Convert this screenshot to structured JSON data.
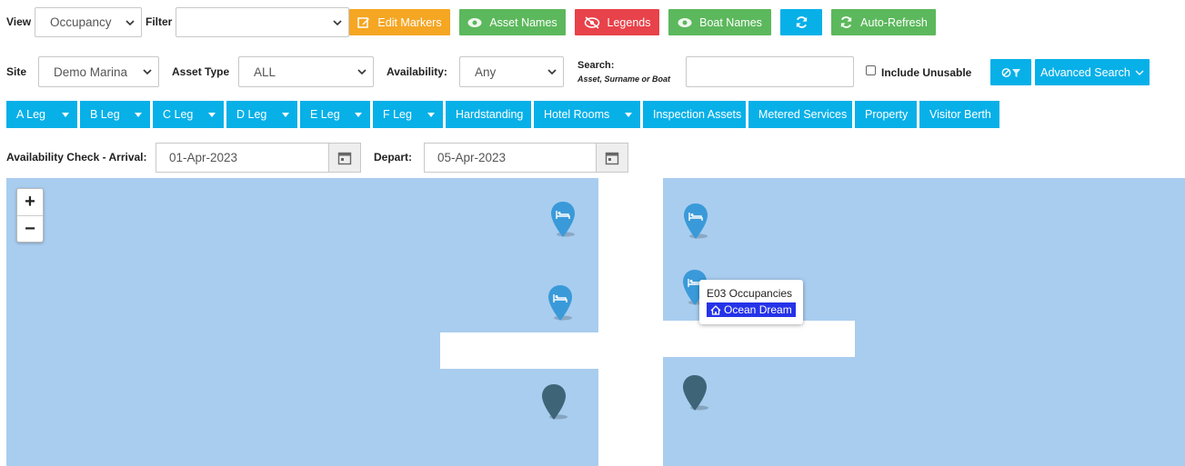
{
  "row1": {
    "view_label": "View",
    "view_value": "Occupancy",
    "filter_label": "Filter",
    "filter_value": "",
    "buttons": {
      "edit_markers": "Edit Markers",
      "asset_names": "Asset Names",
      "legends": "Legends",
      "boat_names": "Boat Names",
      "auto_refresh": "Auto-Refresh"
    },
    "colors": {
      "orange": "#f5a623",
      "green": "#5cb85c",
      "red": "#e8424a",
      "cyan": "#08b0e8"
    }
  },
  "row2": {
    "site_label": "Site",
    "site_value": "Demo Marina",
    "asset_type_label": "Asset Type",
    "asset_type_value": "ALL",
    "availability_label": "Availability:",
    "availability_value": "Any",
    "search_label": "Search:",
    "search_hint": "Asset, Surname or Boat",
    "search_value": "",
    "include_unusable_label": "Include Unusable",
    "advanced_search_label": "Advanced Search"
  },
  "legs": [
    {
      "label": "A Leg",
      "dropdown": true
    },
    {
      "label": "B Leg",
      "dropdown": true
    },
    {
      "label": "C Leg",
      "dropdown": true
    },
    {
      "label": "D Leg",
      "dropdown": true
    },
    {
      "label": "E Leg",
      "dropdown": true
    },
    {
      "label": "F Leg",
      "dropdown": true
    },
    {
      "label": "Hardstanding",
      "dropdown": false
    },
    {
      "label": "Hotel Rooms",
      "dropdown": true
    },
    {
      "label": "Inspection Assets",
      "dropdown": false
    },
    {
      "label": "Metered Services",
      "dropdown": false
    },
    {
      "label": "Property",
      "dropdown": false
    },
    {
      "label": "Visitor Berth",
      "dropdown": false
    }
  ],
  "availability_check": {
    "arrival_label": "Availability Check - Arrival:",
    "arrival_value": "01-Apr-2023",
    "depart_label": "Depart:",
    "depart_value": "05-Apr-2023"
  },
  "map": {
    "zoom_in": "+",
    "zoom_out": "−",
    "water_color": "#a9cdef",
    "tooltip": {
      "title": "E03 Occupancies",
      "boat": "Ocean Dream"
    }
  }
}
